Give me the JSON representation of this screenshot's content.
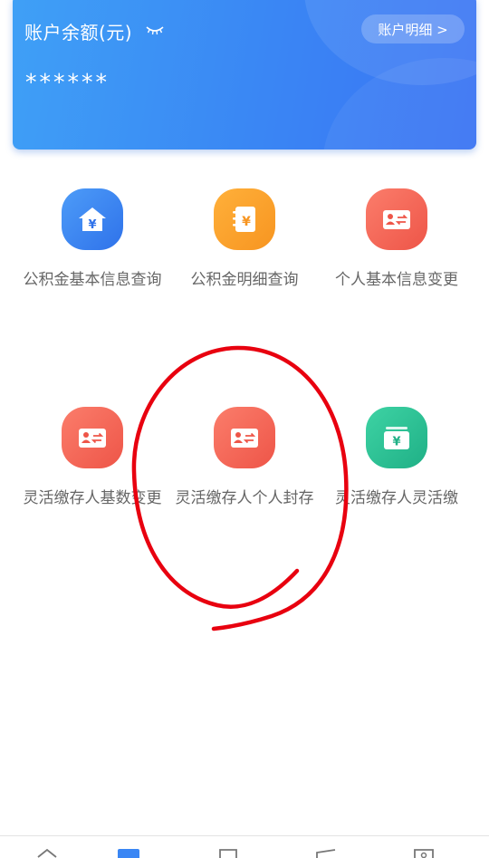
{
  "balance": {
    "title": "账户余额(元)",
    "value": "******",
    "detail_button": "账户明细 >",
    "eye_icon": "eye-closed-icon"
  },
  "services": [
    {
      "label": "公积金基本信息查询",
      "icon": "house-yen-icon",
      "color": "#3a86f4"
    },
    {
      "label": "公积金明细查询",
      "icon": "notebook-yen-icon",
      "color": "#f79521"
    },
    {
      "label": "个人基本信息变更",
      "icon": "id-card-transfer-icon",
      "color": "#ee5548"
    },
    {
      "label": "灵活缴存人基数变更",
      "icon": "id-card-transfer-icon",
      "color": "#ee5548"
    },
    {
      "label": "灵活缴存人个人封存",
      "icon": "id-card-transfer-icon",
      "color": "#ee5548"
    },
    {
      "label": "灵活缴存人灵活缴",
      "icon": "wallet-yen-icon",
      "color": "#1fb086"
    }
  ],
  "bottom_nav": {
    "items": [
      "home-icon",
      "category-icon",
      "document-icon",
      "message-icon",
      "profile-icon"
    ],
    "active_index": 1
  },
  "colors": {
    "accent": "#3a86f4",
    "annotation": "#e8000f"
  }
}
